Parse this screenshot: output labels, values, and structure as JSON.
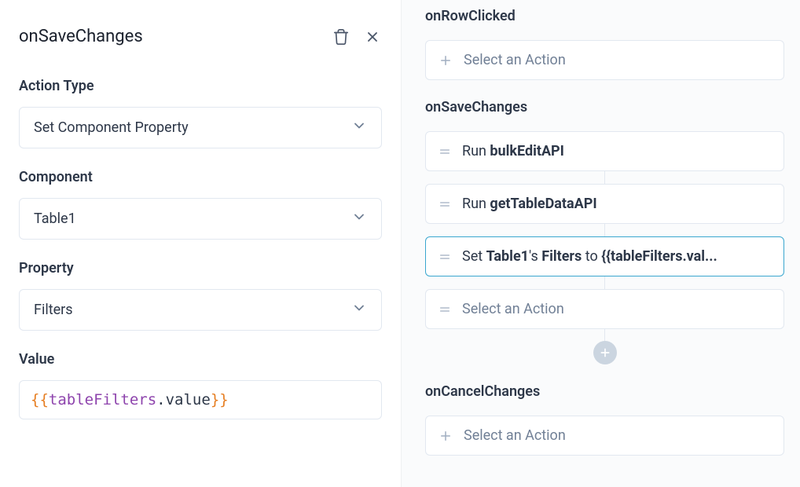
{
  "header": {
    "title": "onSaveChanges"
  },
  "form": {
    "actionType": {
      "label": "Action Type",
      "value": "Set Component Property"
    },
    "component": {
      "label": "Component",
      "value": "Table1"
    },
    "property": {
      "label": "Property",
      "value": "Filters"
    },
    "value": {
      "label": "Value",
      "bracesOpen": "{{",
      "ident": "tableFilters",
      "dotProp": ".value",
      "bracesClose": "}}"
    }
  },
  "events": {
    "onRowClicked": {
      "title": "onRowClicked",
      "placeholder": "Select an Action"
    },
    "onSaveChanges": {
      "title": "onSaveChanges",
      "items": [
        {
          "prefix": "Run ",
          "bold1": "bulkEditAPI"
        },
        {
          "prefix": "Run ",
          "bold1": "getTableDataAPI"
        },
        {
          "prefix": "Set ",
          "bold1": "Table1",
          "mid1": "'s ",
          "bold2": "Filters",
          "mid2": " to ",
          "bold3": "{{tableFilters.val..."
        }
      ],
      "placeholder": "Select an Action"
    },
    "onCancelChanges": {
      "title": "onCancelChanges",
      "placeholder": "Select an Action"
    }
  }
}
